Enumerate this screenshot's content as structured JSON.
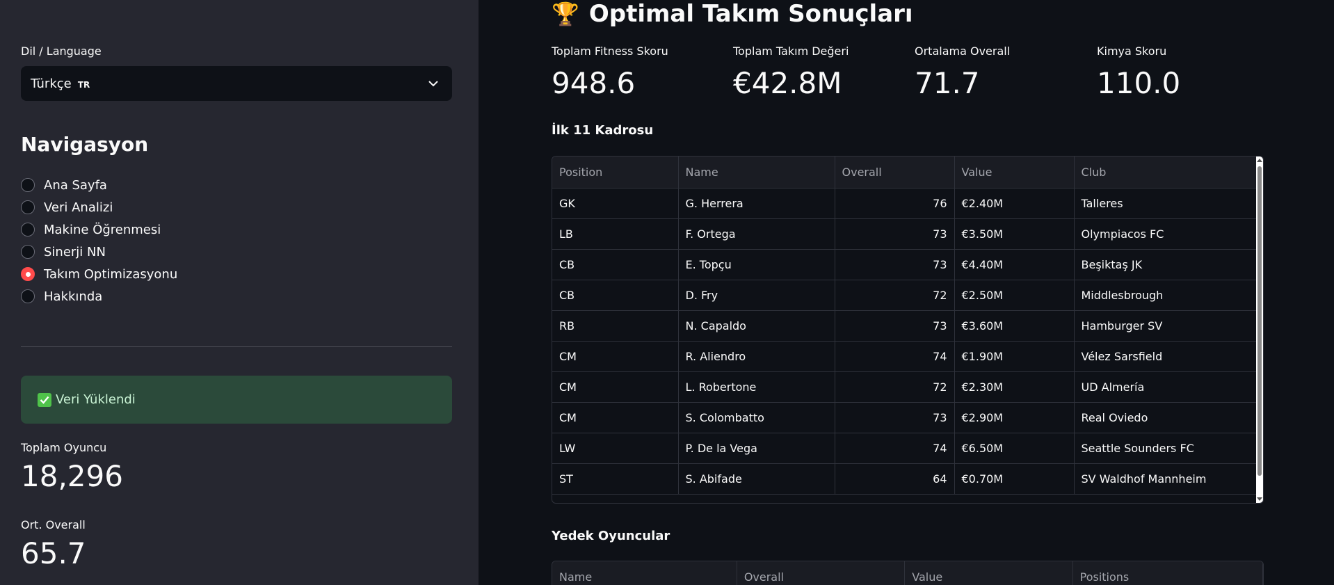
{
  "sidebar": {
    "lang_label": "Dil / Language",
    "lang_value": "Türkçe",
    "lang_flag": "TR",
    "nav_title": "Navigasyon",
    "nav_items": [
      {
        "label": "Ana Sayfa",
        "selected": false
      },
      {
        "label": "Veri Analizi",
        "selected": false
      },
      {
        "label": "Makine Öğrenmesi",
        "selected": false
      },
      {
        "label": "Sinerji NN",
        "selected": false
      },
      {
        "label": "Takım Optimizasyonu",
        "selected": true
      },
      {
        "label": "Hakkında",
        "selected": false
      }
    ],
    "success_text": "Veri Yüklendi",
    "metric1_label": "Toplam Oyuncu",
    "metric1_value": "18,296",
    "metric2_label": "Ort. Overall",
    "metric2_value": "65.7"
  },
  "main": {
    "title_icon": "🏆",
    "title": "Optimal Takım Sonuçları",
    "metrics": [
      {
        "label": "Toplam Fitness Skoru",
        "value": "948.6"
      },
      {
        "label": "Toplam Takım Değeri",
        "value": "€42.8M"
      },
      {
        "label": "Ortalama Overall",
        "value": "71.7"
      },
      {
        "label": "Kimya Skoru",
        "value": "110.0"
      }
    ],
    "starting_title": "İlk 11 Kadrosu",
    "starting_columns": [
      "Position",
      "Name",
      "Overall",
      "Value",
      "Club"
    ],
    "starting_rows": [
      [
        "GK",
        "G. Herrera",
        "76",
        "€2.40M",
        "Talleres"
      ],
      [
        "LB",
        "F. Ortega",
        "73",
        "€3.50M",
        "Olympiacos FC"
      ],
      [
        "CB",
        "E. Topçu",
        "73",
        "€4.40M",
        "Beşiktaş JK"
      ],
      [
        "CB",
        "D. Fry",
        "72",
        "€2.50M",
        "Middlesbrough"
      ],
      [
        "RB",
        "N. Capaldo",
        "73",
        "€3.60M",
        "Hamburger SV"
      ],
      [
        "CM",
        "R. Aliendro",
        "74",
        "€1.90M",
        "Vélez Sarsfield"
      ],
      [
        "CM",
        "L. Robertone",
        "72",
        "€2.30M",
        "UD Almería"
      ],
      [
        "CM",
        "S. Colombatto",
        "73",
        "€2.90M",
        "Real Oviedo"
      ],
      [
        "LW",
        "P. De la Vega",
        "74",
        "€6.50M",
        "Seattle Sounders FC"
      ],
      [
        "ST",
        "S. Abifade",
        "64",
        "€0.70M",
        "SV Waldhof Mannheim"
      ]
    ],
    "subs_title": "Yedek Oyuncular",
    "subs_columns": [
      "Name",
      "Overall",
      "Value",
      "Positions"
    ]
  },
  "colors": {
    "accent": "#ff4b4b",
    "sidebar_bg": "#262730",
    "main_bg": "#0e1117",
    "success_bg": "#2b4a3a"
  }
}
